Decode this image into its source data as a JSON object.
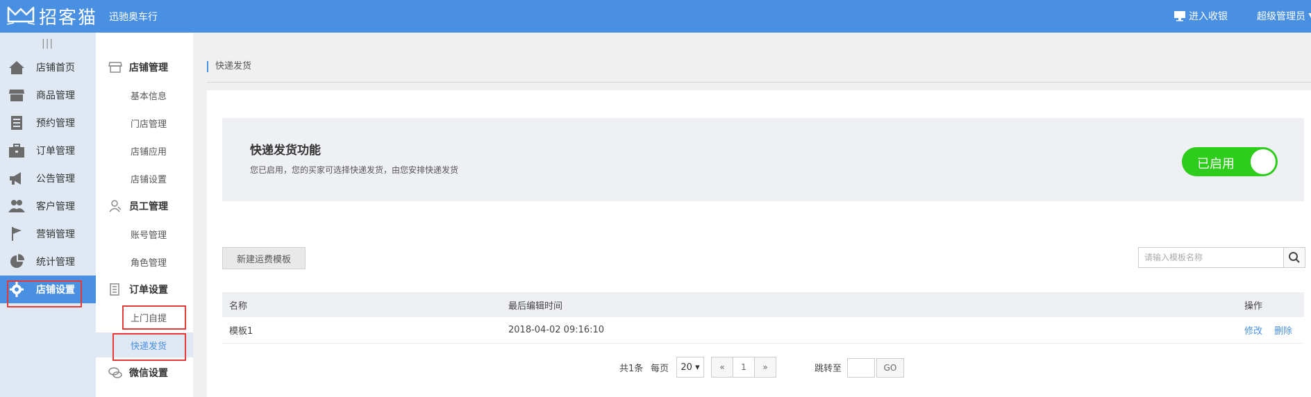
{
  "topbar": {
    "logo_text": "招客猫",
    "store_name": "迅驰奥车行",
    "cashier_label": "进入收银",
    "admin_label": "超级管理员 ▼"
  },
  "sidebar": {
    "collapse_icon": "|||",
    "items": [
      {
        "label": "店铺首页",
        "icon": "home-icon"
      },
      {
        "label": "商品管理",
        "icon": "store-icon"
      },
      {
        "label": "预约管理",
        "icon": "document-icon"
      },
      {
        "label": "订单管理",
        "icon": "briefcase-icon"
      },
      {
        "label": "公告管理",
        "icon": "megaphone-icon"
      },
      {
        "label": "客户管理",
        "icon": "users-icon"
      },
      {
        "label": "营销管理",
        "icon": "flag-icon"
      },
      {
        "label": "统计管理",
        "icon": "pie-chart-icon"
      },
      {
        "label": "店铺设置",
        "icon": "gear-icon"
      }
    ]
  },
  "subnav": {
    "group_store": "店铺管理",
    "store_items": [
      "基本信息",
      "门店管理",
      "店铺应用",
      "店铺设置"
    ],
    "group_staff": "员工管理",
    "staff_items": [
      "账号管理",
      "角色管理"
    ],
    "group_order": "订单设置",
    "order_items": [
      "上门自提",
      "快递发货"
    ],
    "group_wechat": "微信设置"
  },
  "breadcrumb": "快递发货",
  "feature": {
    "title": "快递发货功能",
    "description": "您已启用，您的买家可选择快递发货，由您安排快递发货",
    "toggle_label": "已启用",
    "toggle_color": "#2ecc1b"
  },
  "toolbar": {
    "new_template": "新建运费模板",
    "search_placeholder": "请输入模板名称"
  },
  "table": {
    "headers": [
      "名称",
      "最后编辑时间",
      "操作"
    ],
    "rows": [
      {
        "name": "模板1",
        "edited": "2018-04-02 09:16:10",
        "edit": "修改",
        "delete": "删除"
      }
    ]
  },
  "pagination": {
    "total": "共1条",
    "per_page_label": "每页",
    "per_page_value": "20 ▾",
    "prev": "«",
    "current": "1",
    "next": "»",
    "jump_label": "跳转至",
    "go": "GO"
  },
  "colors": {
    "accent": "#4a90e2",
    "highlight": "#e53935"
  }
}
